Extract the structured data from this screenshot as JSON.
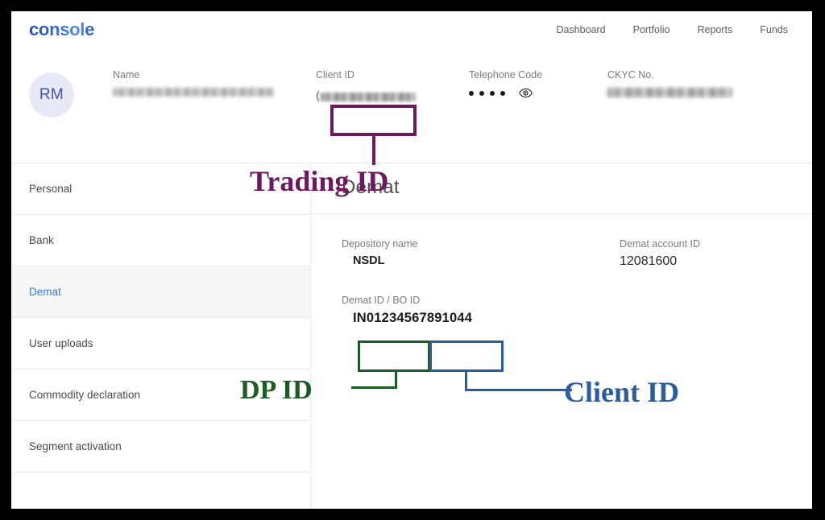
{
  "window": {
    "frame_color": "#000000",
    "background": "#ffffff"
  },
  "header": {
    "logo_text": "console",
    "logo_color": "#2b4fa2",
    "nav_items": [
      {
        "label": "Dashboard"
      },
      {
        "label": "Portfolio"
      },
      {
        "label": "Reports"
      },
      {
        "label": "Funds"
      }
    ]
  },
  "profile": {
    "avatar_initials": "RM",
    "avatar_bg": "#e8e9f6",
    "avatar_color": "#4a4fa8",
    "fields": [
      {
        "label": "Name",
        "value": "",
        "redacted": true
      },
      {
        "label": "Client ID",
        "value": "",
        "redacted": true
      },
      {
        "label": "Telephone Code",
        "value": "••••",
        "masked": true
      },
      {
        "label": "CKYC No.",
        "value": "",
        "redacted": true
      }
    ],
    "name_label": "Name",
    "client_id_label": "Client ID",
    "telephone_code_label": "Telephone Code",
    "telephone_code_mask": "••••",
    "ckyc_label": "CKYC No.",
    "eye_icon": "eye-icon"
  },
  "sidebar": {
    "items": [
      {
        "label": "Personal",
        "active": false
      },
      {
        "label": "Bank",
        "active": false
      },
      {
        "label": "Demat",
        "active": true
      },
      {
        "label": "User uploads",
        "active": false
      },
      {
        "label": "Commodity declaration",
        "active": false
      },
      {
        "label": "Segment activation",
        "active": false
      }
    ],
    "active_color": "#3a7bd5",
    "active_bg": "#f6f6f6"
  },
  "main": {
    "title": "Demat",
    "depository_name_label": "Depository name",
    "depository_name_value": "NSDL",
    "demat_account_id_label": "Demat account ID",
    "demat_account_id_value": "12081600",
    "demat_id_label": "Demat ID / BO ID",
    "demat_id_value": "IN01234567891044",
    "demat_id_dp_part": "IN012345",
    "demat_id_client_part": "67891044"
  },
  "annotations": [
    {
      "label": "Trading ID",
      "color": "#6b1a5e",
      "target": "Client ID field in profile header",
      "box_color": "#6b1a5e"
    },
    {
      "label": "DP ID",
      "color": "#1a5c24",
      "target": "IN012345 portion of Demat ID / BO ID",
      "box_color": "#1a5c24"
    },
    {
      "label": "Client ID",
      "color": "#2b5c9e",
      "target": "67891044 portion of Demat ID / BO ID",
      "box_color": "#2b5c9e"
    }
  ]
}
